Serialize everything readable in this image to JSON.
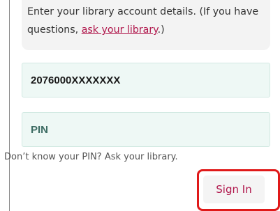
{
  "info": {
    "text_before": "Enter your library account details. (If you have questions, ",
    "link": "ask your library",
    "text_after": ".)"
  },
  "barcode": {
    "value": "2076000XXXXXXX"
  },
  "pin": {
    "placeholder": "PIN"
  },
  "pin_help": "Don’t know your PIN? Ask your library.",
  "sign_in": {
    "label": "Sign In"
  },
  "colors": {
    "accent": "#b0164b",
    "highlight": "#e01919"
  }
}
